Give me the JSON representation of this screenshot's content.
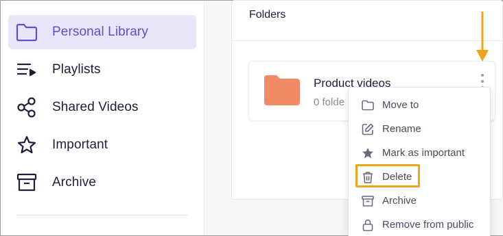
{
  "sidebar": {
    "items": [
      {
        "label": "Personal Library",
        "icon": "folder-icon",
        "active": true
      },
      {
        "label": "Playlists",
        "icon": "playlist-icon",
        "active": false
      },
      {
        "label": "Shared Videos",
        "icon": "share-icon",
        "active": false
      },
      {
        "label": "Important",
        "icon": "star-icon",
        "active": false
      },
      {
        "label": "Archive",
        "icon": "archive-icon",
        "active": false
      }
    ]
  },
  "main": {
    "section_title": "Folders",
    "folder": {
      "name": "Product videos",
      "meta": "0 folde",
      "color": "#f28b65"
    }
  },
  "context_menu": {
    "items": [
      {
        "label": "Move to",
        "icon": "folder-outline-icon"
      },
      {
        "label": "Rename",
        "icon": "edit-icon"
      },
      {
        "label": "Mark as important",
        "icon": "star-filled-icon"
      },
      {
        "label": "Delete",
        "icon": "trash-icon"
      },
      {
        "label": "Archive",
        "icon": "archive-icon"
      },
      {
        "label": "Remove from public",
        "icon": "lock-icon"
      }
    ]
  },
  "colors": {
    "accent": "#5a4fd6",
    "active_bg": "#e9e6fb",
    "annotation": "#f0a31b",
    "text": "#1d1d3b"
  }
}
